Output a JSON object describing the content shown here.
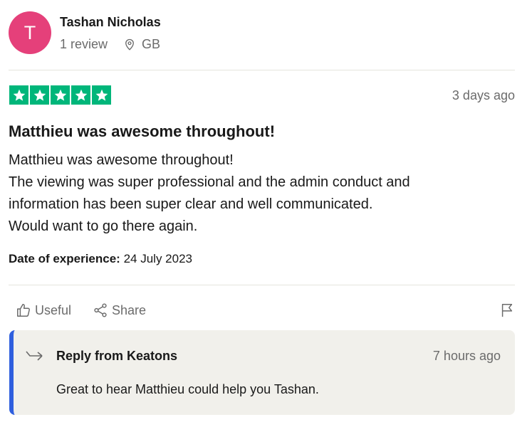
{
  "reviewer": {
    "avatar_letter": "T",
    "avatar_color": "#e5407a",
    "name": "Tashan Nicholas",
    "review_count": "1 review",
    "country": "GB"
  },
  "review": {
    "rating": 5,
    "star_color": "#00b67a",
    "time": "3 days ago",
    "title": "Matthieu was awesome throughout!",
    "body_lines": [
      "Matthieu was awesome throughout!",
      "The viewing was super professional and the admin conduct and",
      "information has been super clear and well communicated.",
      "Would want to go there again."
    ],
    "experience_label": "Date of experience:",
    "experience_date": "24 July 2023"
  },
  "actions": {
    "useful_label": "Useful",
    "share_label": "Share"
  },
  "reply": {
    "title": "Reply from Keatons",
    "time": "7 hours ago",
    "text": "Great to hear Matthieu could help you Tashan.",
    "accent_color": "#2f5fde"
  }
}
